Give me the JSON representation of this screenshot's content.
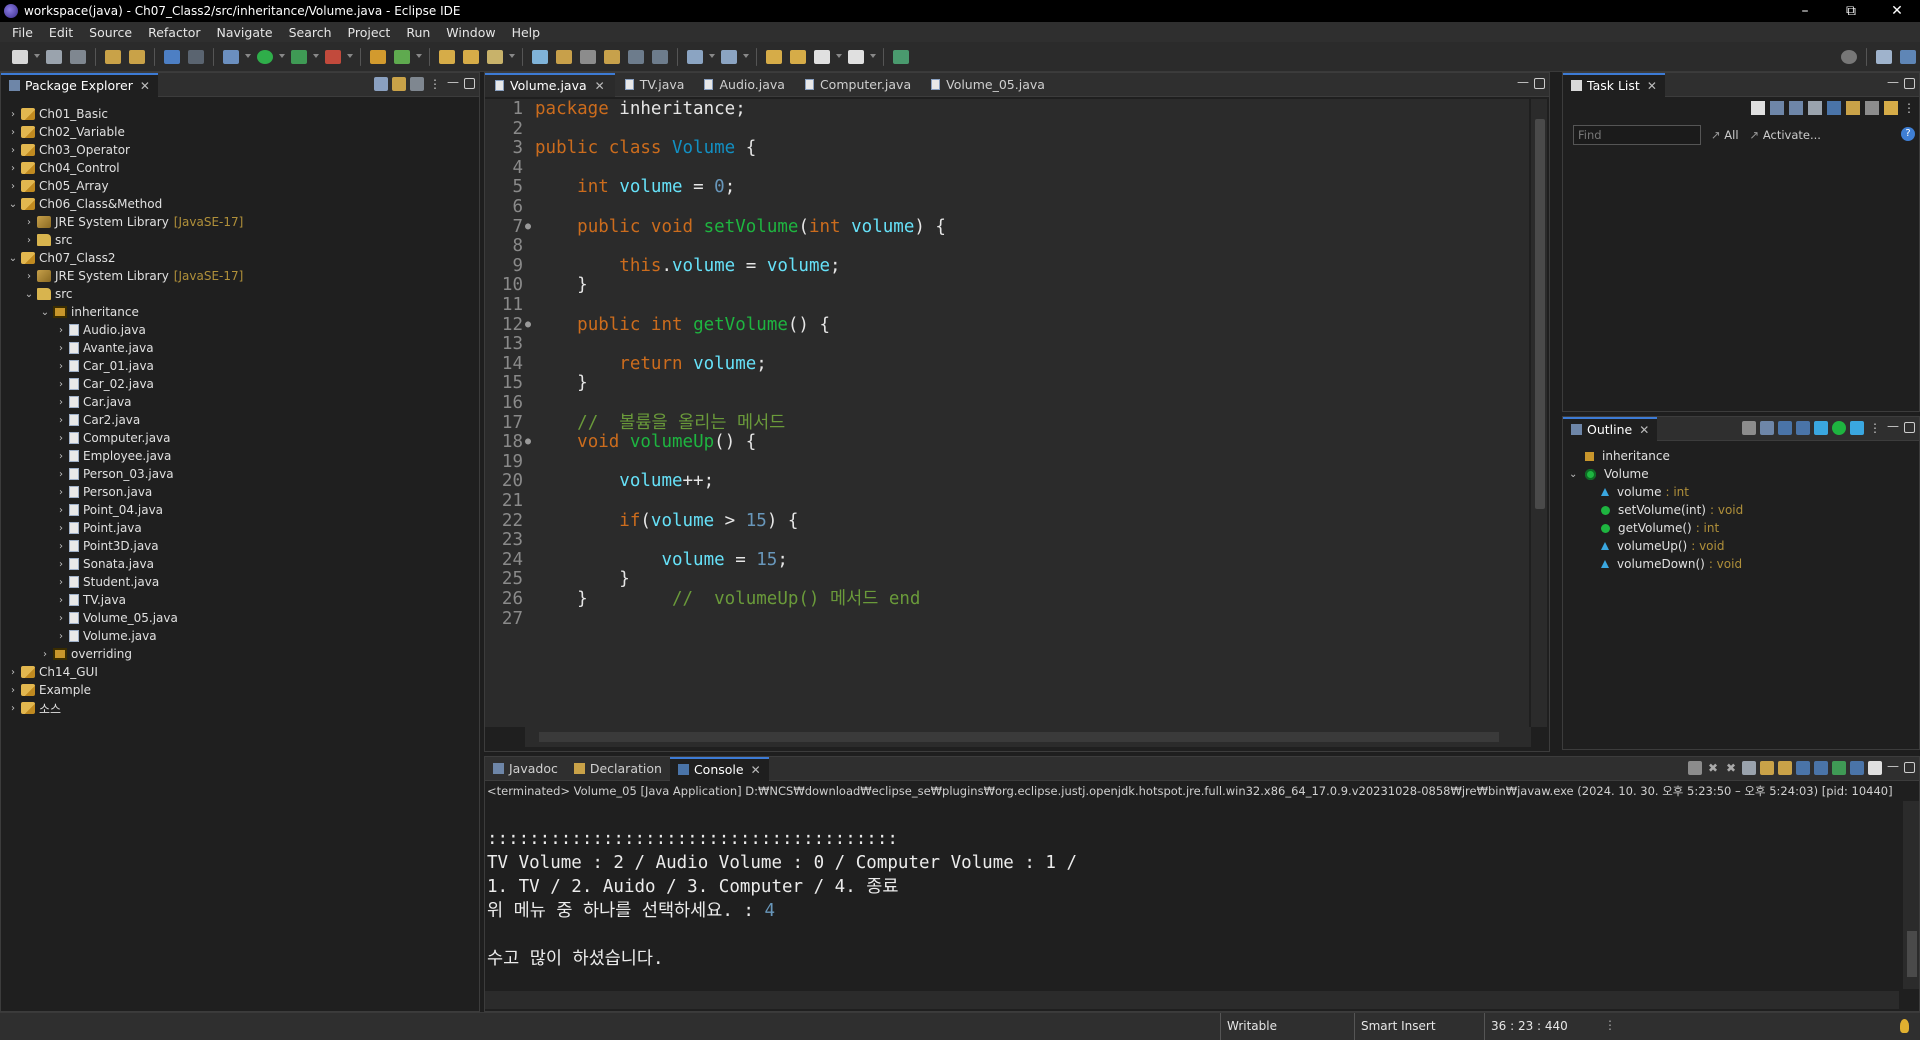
{
  "window": {
    "title": "workspace(java) - Ch07_Class2/src/inheritance/Volume.java - Eclipse IDE",
    "buttons": [
      "–",
      "⧉",
      "✕"
    ]
  },
  "menu": [
    "File",
    "Edit",
    "Source",
    "Refactor",
    "Navigate",
    "Search",
    "Project",
    "Run",
    "Window",
    "Help"
  ],
  "package_explorer": {
    "tab_label": "Package Explorer",
    "tree": [
      {
        "label": "Ch01_Basic",
        "icon": "project",
        "twisty": "›",
        "level": 0
      },
      {
        "label": "Ch02_Variable",
        "icon": "project",
        "twisty": "›",
        "level": 0
      },
      {
        "label": "Ch03_Operator",
        "icon": "project",
        "twisty": "›",
        "level": 0
      },
      {
        "label": "Ch04_Control",
        "icon": "project",
        "twisty": "›",
        "level": 0
      },
      {
        "label": "Ch05_Array",
        "icon": "project",
        "twisty": "›",
        "level": 0
      },
      {
        "label": "Ch06_Class&Method",
        "icon": "project",
        "twisty": "⌄",
        "level": 0
      },
      {
        "label": "JRE System Library",
        "decoration": "[JavaSE-17]",
        "icon": "jre",
        "twisty": "›",
        "level": 1
      },
      {
        "label": "src",
        "icon": "srcf",
        "twisty": "›",
        "level": 1
      },
      {
        "label": "Ch07_Class2",
        "icon": "project",
        "twisty": "⌄",
        "level": 0
      },
      {
        "label": "JRE System Library",
        "decoration": "[JavaSE-17]",
        "icon": "jre",
        "twisty": "›",
        "level": 1
      },
      {
        "label": "src",
        "icon": "srcf",
        "twisty": "⌄",
        "level": 1
      },
      {
        "label": "inheritance",
        "icon": "pkgi",
        "twisty": "⌄",
        "level": 2
      },
      {
        "label": "Audio.java",
        "icon": "javaf",
        "twisty": "›",
        "level": 3
      },
      {
        "label": "Avante.java",
        "icon": "javaf",
        "twisty": "›",
        "level": 3
      },
      {
        "label": "Car_01.java",
        "icon": "javaf",
        "twisty": "›",
        "level": 3
      },
      {
        "label": "Car_02.java",
        "icon": "javaf",
        "twisty": "›",
        "level": 3
      },
      {
        "label": "Car.java",
        "icon": "javaf",
        "twisty": "›",
        "level": 3
      },
      {
        "label": "Car2.java",
        "icon": "javaf",
        "twisty": "›",
        "level": 3
      },
      {
        "label": "Computer.java",
        "icon": "javaf",
        "twisty": "›",
        "level": 3
      },
      {
        "label": "Employee.java",
        "icon": "javaf",
        "twisty": "›",
        "level": 3
      },
      {
        "label": "Person_03.java",
        "icon": "javaf",
        "twisty": "›",
        "level": 3
      },
      {
        "label": "Person.java",
        "icon": "javaf",
        "twisty": "›",
        "level": 3
      },
      {
        "label": "Point_04.java",
        "icon": "javaf",
        "twisty": "›",
        "level": 3
      },
      {
        "label": "Point.java",
        "icon": "javaf",
        "twisty": "›",
        "level": 3
      },
      {
        "label": "Point3D.java",
        "icon": "javaf",
        "twisty": "›",
        "level": 3
      },
      {
        "label": "Sonata.java",
        "icon": "javaf",
        "twisty": "›",
        "level": 3
      },
      {
        "label": "Student.java",
        "icon": "javaf",
        "twisty": "›",
        "level": 3
      },
      {
        "label": "TV.java",
        "icon": "javaf",
        "twisty": "›",
        "level": 3
      },
      {
        "label": "Volume_05.java",
        "icon": "javaf",
        "twisty": "›",
        "level": 3
      },
      {
        "label": "Volume.java",
        "icon": "javaf",
        "twisty": "›",
        "level": 3
      },
      {
        "label": "overriding",
        "icon": "pkgi",
        "twisty": "›",
        "level": 2
      },
      {
        "label": "Ch14_GUI",
        "icon": "project",
        "twisty": "›",
        "level": 0
      },
      {
        "label": "Example",
        "icon": "project",
        "twisty": "›",
        "level": 0
      },
      {
        "label": "소스",
        "icon": "project",
        "twisty": "›",
        "level": 0
      }
    ]
  },
  "editor": {
    "tabs": [
      {
        "label": "Volume.java",
        "active": true
      },
      {
        "label": "TV.java",
        "active": false
      },
      {
        "label": "Audio.java",
        "active": false
      },
      {
        "label": "Computer.java",
        "active": false
      },
      {
        "label": "Volume_05.java",
        "active": false
      }
    ],
    "lines": [
      {
        "n": "1",
        "tokens": [
          [
            "kw",
            "package"
          ],
          [
            "pl",
            " inheritance;"
          ]
        ]
      },
      {
        "n": "2",
        "tokens": []
      },
      {
        "n": "3",
        "tokens": [
          [
            "kw",
            "public class"
          ],
          [
            "pl",
            " "
          ],
          [
            "ty",
            "Volume"
          ],
          [
            "pl",
            " {"
          ]
        ]
      },
      {
        "n": "4",
        "tokens": []
      },
      {
        "n": "5",
        "tokens": [
          [
            "pl",
            "    "
          ],
          [
            "kw",
            "int"
          ],
          [
            "pl",
            " "
          ],
          [
            "fd",
            "volume"
          ],
          [
            "pl",
            " = "
          ],
          [
            "num",
            "0"
          ],
          [
            "pl",
            ";"
          ]
        ]
      },
      {
        "n": "6",
        "tokens": []
      },
      {
        "n": "7",
        "marker": true,
        "tokens": [
          [
            "pl",
            "    "
          ],
          [
            "kw",
            "public void"
          ],
          [
            "pl",
            " "
          ],
          [
            "mt",
            "setVolume"
          ],
          [
            "pl",
            "("
          ],
          [
            "kw",
            "int"
          ],
          [
            "pl",
            " "
          ],
          [
            "fd",
            "volume"
          ],
          [
            "pl",
            ") {"
          ]
        ]
      },
      {
        "n": "8",
        "tokens": []
      },
      {
        "n": "9",
        "tokens": [
          [
            "pl",
            "        "
          ],
          [
            "kw",
            "this"
          ],
          [
            "pl",
            "."
          ],
          [
            "fd",
            "volume"
          ],
          [
            "pl",
            " = "
          ],
          [
            "fd",
            "volume"
          ],
          [
            "pl",
            ";"
          ]
        ]
      },
      {
        "n": "10",
        "tokens": [
          [
            "pl",
            "    }"
          ]
        ]
      },
      {
        "n": "11",
        "tokens": []
      },
      {
        "n": "12",
        "marker": true,
        "tokens": [
          [
            "pl",
            "    "
          ],
          [
            "kw",
            "public int"
          ],
          [
            "pl",
            " "
          ],
          [
            "mt",
            "getVolume"
          ],
          [
            "pl",
            "() {"
          ]
        ]
      },
      {
        "n": "13",
        "tokens": []
      },
      {
        "n": "14",
        "tokens": [
          [
            "pl",
            "        "
          ],
          [
            "kw",
            "return"
          ],
          [
            "pl",
            " "
          ],
          [
            "fd",
            "volume"
          ],
          [
            "pl",
            ";"
          ]
        ]
      },
      {
        "n": "15",
        "tokens": [
          [
            "pl",
            "    }"
          ]
        ]
      },
      {
        "n": "16",
        "tokens": []
      },
      {
        "n": "17",
        "tokens": [
          [
            "pl",
            "    "
          ],
          [
            "cm",
            "//  볼륨을 올리는 메서드"
          ]
        ]
      },
      {
        "n": "18",
        "marker": true,
        "tokens": [
          [
            "pl",
            "    "
          ],
          [
            "kw",
            "void"
          ],
          [
            "pl",
            " "
          ],
          [
            "mt",
            "volumeUp"
          ],
          [
            "pl",
            "() {"
          ]
        ]
      },
      {
        "n": "19",
        "tokens": []
      },
      {
        "n": "20",
        "tokens": [
          [
            "pl",
            "        "
          ],
          [
            "fd",
            "volume"
          ],
          [
            "pl",
            "++;"
          ]
        ]
      },
      {
        "n": "21",
        "tokens": []
      },
      {
        "n": "22",
        "tokens": [
          [
            "pl",
            "        "
          ],
          [
            "kw",
            "if"
          ],
          [
            "pl",
            "("
          ],
          [
            "fd",
            "volume"
          ],
          [
            "pl",
            " > "
          ],
          [
            "num",
            "15"
          ],
          [
            "pl",
            ") {"
          ]
        ]
      },
      {
        "n": "23",
        "tokens": []
      },
      {
        "n": "24",
        "tokens": [
          [
            "pl",
            "            "
          ],
          [
            "fd",
            "volume"
          ],
          [
            "pl",
            " = "
          ],
          [
            "num",
            "15"
          ],
          [
            "pl",
            ";"
          ]
        ]
      },
      {
        "n": "25",
        "tokens": [
          [
            "pl",
            "        }"
          ]
        ]
      },
      {
        "n": "26",
        "tokens": [
          [
            "pl",
            "    }        "
          ],
          [
            "cm",
            "//  volumeUp() 메서드 end"
          ]
        ]
      },
      {
        "n": "27",
        "tokens": []
      }
    ]
  },
  "task_list": {
    "tab_label": "Task List",
    "find_placeholder": "Find",
    "all_label": "All",
    "activate_label": "Activate...",
    "help": "?"
  },
  "outline": {
    "tab_label": "Outline",
    "items": [
      {
        "label": "inheritance",
        "type": "",
        "icon": "pkg",
        "twisty": "",
        "level": 0
      },
      {
        "label": "Volume",
        "type": "",
        "icon": "cls",
        "twisty": "⌄",
        "level": 0
      },
      {
        "label": "volume",
        "type": ": int",
        "icon": "tri",
        "twisty": "",
        "level": 1
      },
      {
        "label": "setVolume(int)",
        "type": ": void",
        "icon": "dot",
        "twisty": "",
        "level": 1
      },
      {
        "label": "getVolume()",
        "type": ": int",
        "icon": "dot",
        "twisty": "",
        "level": 1
      },
      {
        "label": "volumeUp()",
        "type": ": void",
        "icon": "tri",
        "twisty": "",
        "level": 1
      },
      {
        "label": "volumeDown()",
        "type": ": void",
        "icon": "tri",
        "twisty": "",
        "level": 1
      }
    ]
  },
  "console": {
    "tabs": [
      {
        "label": "Javadoc",
        "active": false
      },
      {
        "label": "Declaration",
        "active": false
      },
      {
        "label": "Console",
        "active": true
      }
    ],
    "terminated": "<terminated> Volume_05 [Java Application] D:₩NCS₩download₩eclipse_se₩plugins₩org.eclipse.justj.openjdk.hotspot.jre.full.win32.x86_64_17.0.9.v20231028-0858₩jre₩bin₩javaw.exe  (2024. 10. 30. 오후 5:23:50 – 오후 5:24:03) [pid: 10440]",
    "lines": [
      {
        "text": "",
        "input": ""
      },
      {
        "text": ":::::::::::::::::::::::::::::::::::::::",
        "input": ""
      },
      {
        "text": "TV Volume : 2 / Audio Volume : 0 / Computer Volume : 1 /",
        "input": ""
      },
      {
        "text": "1. TV / 2. Auido / 3. Computer / 4. 종료",
        "input": ""
      },
      {
        "text": "위 메뉴 중 하나를 선택하세요. : ",
        "input": "4"
      },
      {
        "text": "",
        "input": ""
      },
      {
        "text": "수고 많이 하셨습니다.",
        "input": ""
      }
    ]
  },
  "status": {
    "writable": "Writable",
    "insert_mode": "Smart Insert",
    "position": "36 : 23 : 440"
  },
  "colors": {
    "keyword": "#cc6c1d",
    "field": "#66e1f8",
    "method": "#1eb540",
    "number": "#6897bb",
    "comment": "#6a9a3a",
    "type": "#1290c3",
    "active_tab_border": "#3d7bd5"
  }
}
